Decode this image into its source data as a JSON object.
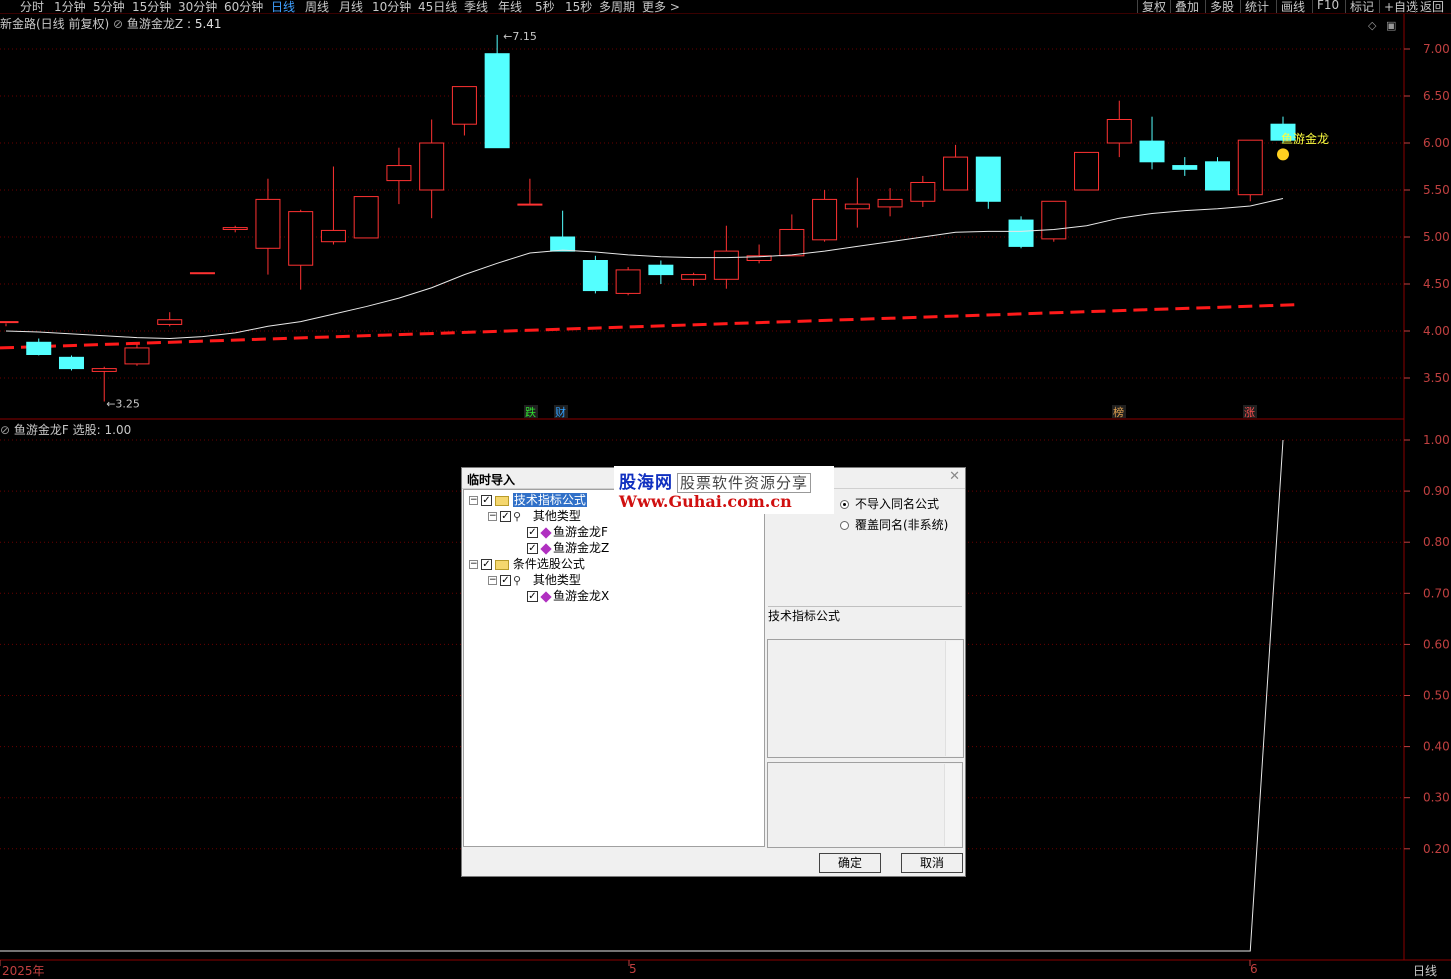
{
  "toolbar": {
    "left_items": [
      "分时",
      "1分钟",
      "5分钟",
      "15分钟",
      "30分钟",
      "60分钟",
      "日线",
      "周线",
      "月线",
      "10分钟",
      "45日线",
      "季线",
      "年线",
      "5秒",
      "15秒",
      "多周期",
      "更多 >"
    ],
    "active": "日线",
    "right_items": [
      "复权",
      "叠加",
      "多股",
      "统计",
      "画线",
      "F10",
      "标记",
      "+自选",
      "返回"
    ]
  },
  "indicator_main": {
    "title": "新金路(日线 前复权)",
    "formula_name": "鱼游金龙Z",
    "formula_value": ": 5.41"
  },
  "indicator_sub": {
    "formula_name": "鱼游金龙F",
    "label": "选股:",
    "value": "1.00"
  },
  "price_axis": [
    "7.00",
    "6.50",
    "6.00",
    "5.50",
    "5.00",
    "4.50",
    "4.00",
    "3.50"
  ],
  "sub_axis": [
    "1.00",
    "0.90",
    "0.80",
    "0.70",
    "0.60",
    "0.50",
    "0.40",
    "0.30",
    "0.20"
  ],
  "annotations": {
    "high": "7.15",
    "low": "3.25",
    "signal_label": "鱼游金龙"
  },
  "event_tags": [
    {
      "text": "跌",
      "color": "#30e030"
    },
    {
      "text": "财",
      "color": "#30a0ff"
    },
    {
      "text": "榜",
      "color": "#e0a050"
    },
    {
      "text": "涨",
      "color": "#ff5050"
    }
  ],
  "date_axis": {
    "start": "2025年",
    "mid": "5",
    "end": "6",
    "period": "日线"
  },
  "dialog": {
    "title": "临时导入",
    "close": "✕",
    "tree": [
      {
        "label": "技术指标公式"
      },
      {
        "label": "其他类型"
      },
      {
        "label": "鱼游金龙F"
      },
      {
        "label": "鱼游金龙Z"
      },
      {
        "label": "条件选股公式"
      },
      {
        "label": "其他类型"
      },
      {
        "label": "鱼游金龙X"
      }
    ],
    "options": [
      "不导入同名公式",
      "覆盖同名(非系统)"
    ],
    "info_label": "技术指标公式",
    "ok": "确定",
    "cancel": "取消"
  },
  "watermark": {
    "line1": "股海网",
    "line1b": "股票软件资源分享",
    "line2": "Www.Guhai.com.cn"
  },
  "chart_data": {
    "type": "candlestick",
    "candles": [
      [
        4.1,
        4.1,
        4.05,
        4.08
      ],
      [
        3.88,
        3.75,
        3.92,
        3.74
      ],
      [
        3.72,
        3.6,
        3.74,
        3.58
      ],
      [
        3.57,
        3.6,
        3.62,
        3.25
      ],
      [
        3.65,
        3.82,
        3.86,
        3.63
      ],
      [
        4.07,
        4.12,
        4.2,
        4.05
      ],
      [
        4.62,
        4.62,
        4.62,
        4.62
      ],
      [
        5.08,
        5.1,
        5.12,
        5.05
      ],
      [
        4.88,
        5.4,
        5.62,
        4.6
      ],
      [
        4.7,
        5.27,
        5.29,
        4.44
      ],
      [
        4.95,
        5.07,
        5.75,
        4.92
      ],
      [
        4.99,
        5.43,
        5.43,
        4.99
      ],
      [
        5.6,
        5.76,
        5.95,
        5.35
      ],
      [
        5.5,
        6.0,
        6.25,
        5.2
      ],
      [
        6.2,
        6.6,
        6.6,
        6.08
      ],
      [
        6.95,
        5.95,
        7.15,
        5.95
      ],
      [
        5.35,
        5.35,
        5.62,
        5.35
      ],
      [
        5.0,
        4.85,
        5.28,
        4.85
      ],
      [
        4.75,
        4.43,
        4.8,
        4.4
      ],
      [
        4.4,
        4.65,
        4.68,
        4.38
      ],
      [
        4.7,
        4.6,
        4.75,
        4.5
      ],
      [
        4.55,
        4.6,
        4.62,
        4.48
      ],
      [
        4.55,
        4.85,
        5.12,
        4.45
      ],
      [
        4.75,
        4.8,
        4.92,
        4.72
      ],
      [
        4.8,
        5.08,
        5.24,
        4.8
      ],
      [
        4.97,
        5.4,
        5.5,
        4.95
      ],
      [
        5.3,
        5.35,
        5.63,
        5.1
      ],
      [
        5.32,
        5.4,
        5.52,
        5.22
      ],
      [
        5.38,
        5.58,
        5.65,
        5.32
      ],
      [
        5.5,
        5.85,
        5.98,
        5.5
      ],
      [
        5.85,
        5.38,
        5.85,
        5.3
      ],
      [
        5.18,
        4.9,
        5.22,
        4.88
      ],
      [
        4.98,
        5.38,
        5.38,
        4.95
      ],
      [
        5.5,
        5.9,
        5.9,
        5.5
      ],
      [
        6.0,
        6.25,
        6.45,
        5.85
      ],
      [
        6.02,
        5.8,
        6.28,
        5.72
      ],
      [
        5.76,
        5.72,
        5.85,
        5.65
      ],
      [
        5.8,
        5.5,
        5.85,
        5.5
      ],
      [
        5.45,
        6.03,
        6.03,
        5.38
      ],
      [
        6.2,
        6.03,
        6.28,
        6.0
      ]
    ],
    "ma_line": [
      4.0,
      3.99,
      3.97,
      3.95,
      3.93,
      3.92,
      3.94,
      3.98,
      4.05,
      4.1,
      4.18,
      4.26,
      4.35,
      4.46,
      4.6,
      4.72,
      4.83,
      4.86,
      4.84,
      4.81,
      4.79,
      4.78,
      4.78,
      4.79,
      4.81,
      4.85,
      4.9,
      4.95,
      5.0,
      5.05,
      5.06,
      5.06,
      5.08,
      5.12,
      5.2,
      5.25,
      5.28,
      5.3,
      5.33,
      5.41
    ],
    "dashed_line": [
      3.82,
      4.28
    ],
    "sub_series": [
      0,
      0,
      0,
      0,
      0,
      0,
      0,
      0,
      0,
      0,
      0,
      0,
      0,
      0,
      0,
      0,
      0,
      0,
      0,
      0,
      0,
      0,
      0,
      0,
      0,
      0,
      0,
      0,
      0,
      0,
      0,
      0,
      0,
      0,
      0,
      0,
      0,
      0,
      0,
      1.0
    ],
    "ylim": [
      3.2,
      7.3
    ]
  },
  "colors": {
    "up": "#ff3232",
    "down": "#54ffff",
    "grid": "#6a0000",
    "axis": "#c04040"
  }
}
